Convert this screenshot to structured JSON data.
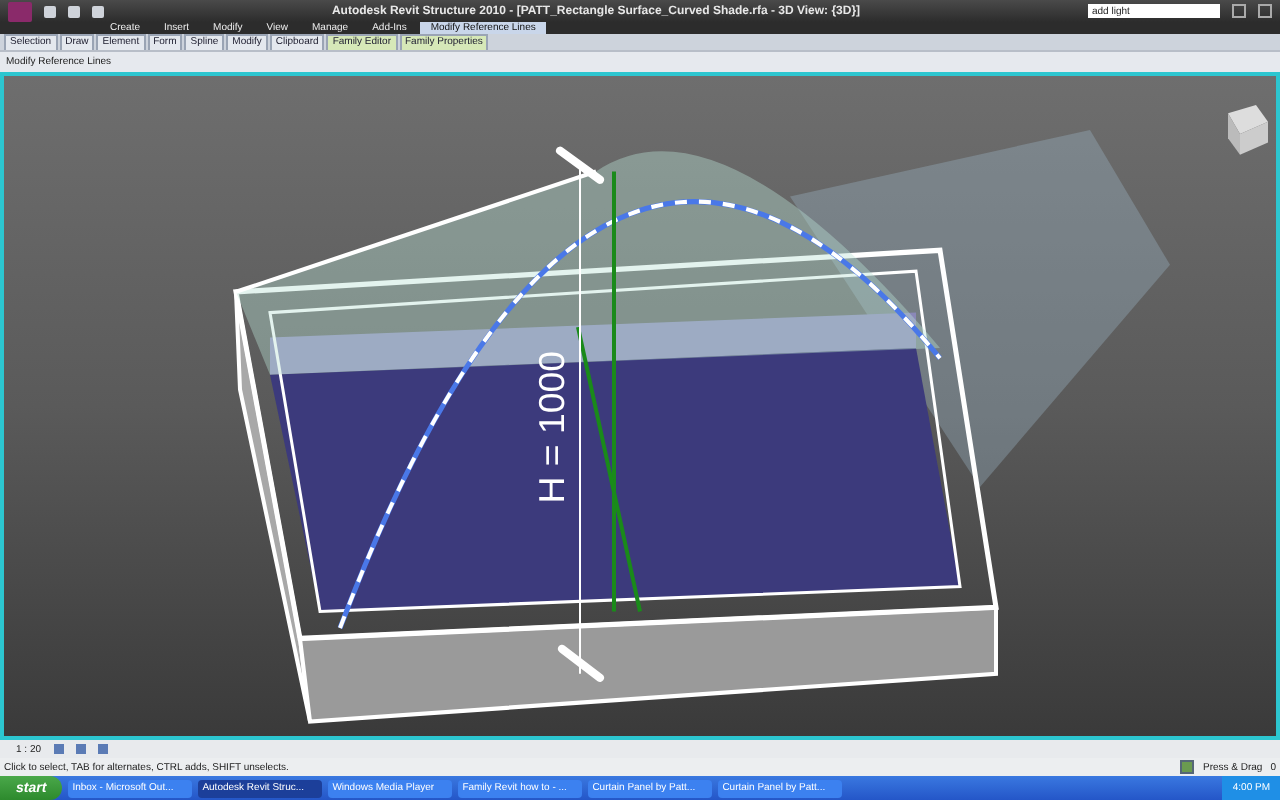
{
  "window": {
    "title": "Autodesk Revit Structure 2010 - [PATT_Rectangle Surface_Curved Shade.rfa - 3D View: {3D}]"
  },
  "search": {
    "value": "add light"
  },
  "ribbon_tabs": [
    {
      "label": "Create",
      "selected": false
    },
    {
      "label": "Insert",
      "selected": false
    },
    {
      "label": "Modify",
      "selected": false
    },
    {
      "label": "View",
      "selected": false
    },
    {
      "label": "Manage",
      "selected": false
    },
    {
      "label": "Add-Ins",
      "selected": false
    },
    {
      "label": "Modify Reference Lines",
      "selected": true
    }
  ],
  "panels": [
    {
      "label": "Selection",
      "kind": "normal"
    },
    {
      "label": "Draw",
      "kind": "normal"
    },
    {
      "label": "Element",
      "kind": "normal"
    },
    {
      "label": "Form",
      "kind": "normal"
    },
    {
      "label": "Spline",
      "kind": "normal"
    },
    {
      "label": "Modify",
      "kind": "normal"
    },
    {
      "label": "Clipboard",
      "kind": "normal"
    },
    {
      "label": "Family Editor",
      "kind": "contextual"
    },
    {
      "label": "Family Properties",
      "kind": "contextual"
    }
  ],
  "options_bar": {
    "label": "Modify Reference Lines"
  },
  "viewport": {
    "dimension_label": "H = 1000"
  },
  "view_bar": {
    "scale": "1 : 20"
  },
  "status_bar": {
    "message": "Click to select, TAB for alternates, CTRL adds, SHIFT unselects.",
    "press_drag": {
      "label": "Press & Drag",
      "checked": true
    },
    "filter_count": "0"
  },
  "taskbar": {
    "start": "start",
    "tasks": [
      {
        "label": "Inbox - Microsoft Out...",
        "selected": false
      },
      {
        "label": "Autodesk Revit Struc...",
        "selected": true
      },
      {
        "label": "Windows Media Player",
        "selected": false
      },
      {
        "label": "Family Revit how to - ...",
        "selected": false
      },
      {
        "label": "Curtain Panel by Patt...",
        "selected": false
      },
      {
        "label": "Curtain Panel by Patt...",
        "selected": false
      }
    ],
    "clock": "4:00 PM"
  }
}
